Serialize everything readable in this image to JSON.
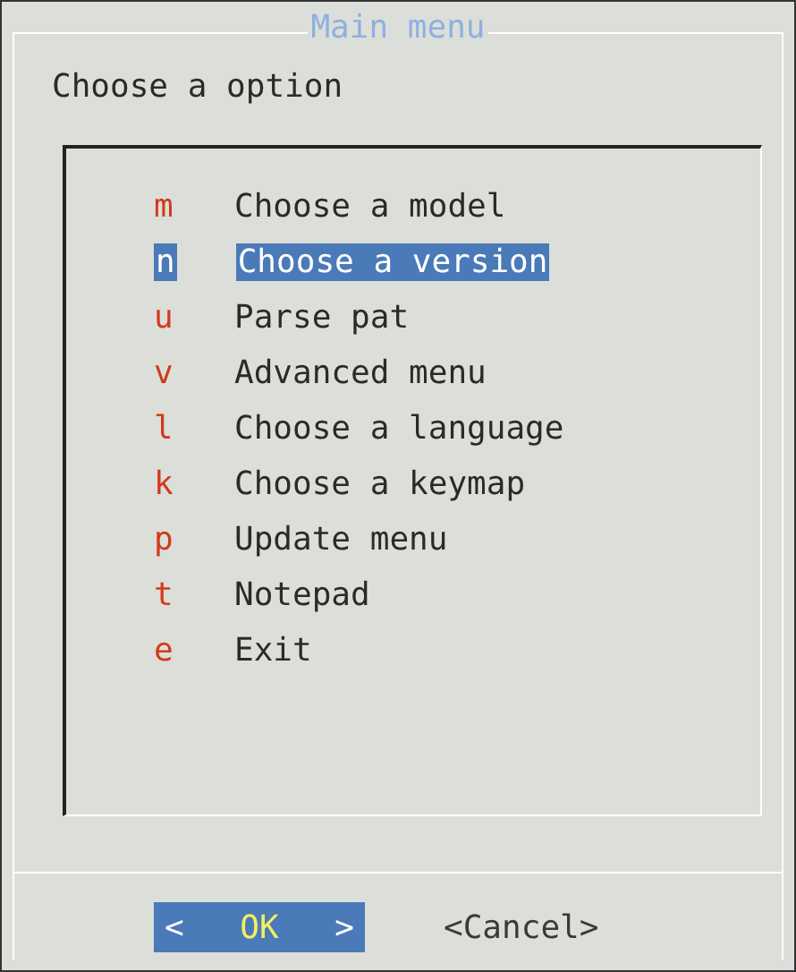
{
  "dialog": {
    "title": "Main menu",
    "prompt": "Choose a option"
  },
  "menu_items": [
    {
      "key": "m",
      "label": "Choose a model",
      "selected": false
    },
    {
      "key": "n",
      "label": "Choose a version",
      "selected": true
    },
    {
      "key": "u",
      "label": "Parse pat",
      "selected": false
    },
    {
      "key": "v",
      "label": "Advanced menu",
      "selected": false
    },
    {
      "key": "l",
      "label": "Choose a language",
      "selected": false
    },
    {
      "key": "k",
      "label": "Choose a keymap",
      "selected": false
    },
    {
      "key": "p",
      "label": "Update menu",
      "selected": false
    },
    {
      "key": "t",
      "label": "Notepad",
      "selected": false
    },
    {
      "key": "e",
      "label": "Exit",
      "selected": false
    }
  ],
  "buttons": [
    {
      "left": "<",
      "label": "OK",
      "right": ">",
      "selected": true
    },
    {
      "left": "<",
      "label": "Cancel",
      "right": ">",
      "selected": false
    }
  ]
}
